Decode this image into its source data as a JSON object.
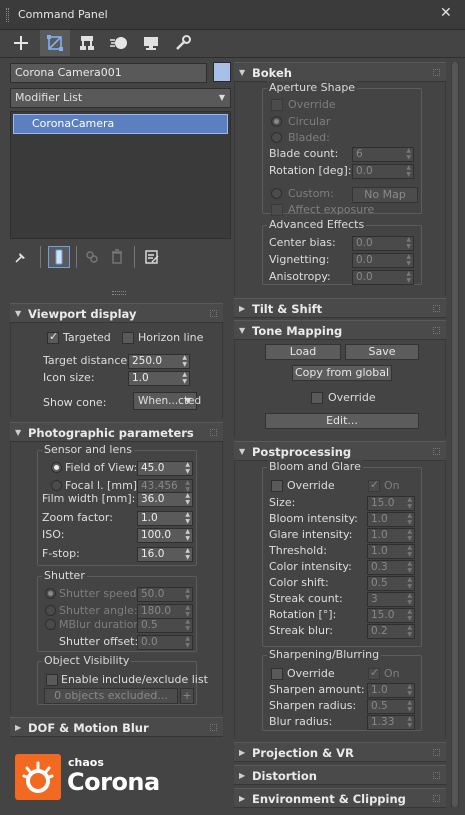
{
  "window": {
    "title": "Command Panel",
    "close": "✕"
  },
  "toolbar": {
    "icons": [
      "create-icon",
      "modify-icon",
      "hierarchy-icon",
      "motion-icon",
      "display-icon",
      "utilities-icon"
    ]
  },
  "object": {
    "name": "Corona Camera001",
    "color": "#a8c0e8"
  },
  "modifier_list": {
    "label": "Modifier List"
  },
  "stack": {
    "items": [
      "CoronaCamera"
    ]
  },
  "left": {
    "viewport_display": {
      "title": "Viewport display",
      "targeted": "Targeted",
      "horizon_line": "Horizon line",
      "target_distance_label": "Target distance:",
      "target_distance": "250.0",
      "icon_size_label": "Icon size:",
      "icon_size": "1.0",
      "show_cone_label": "Show cone:",
      "show_cone_value": "When...cted"
    },
    "photographic": {
      "title": "Photographic parameters",
      "sensor_group": "Sensor and lens",
      "fov_label": "Field of View:",
      "fov": "45.0",
      "focal_label": "Focal l. [mm]:",
      "focal": "43.456",
      "film_width_label": "Film width [mm]:",
      "film_width": "36.0",
      "zoom_label": "Zoom factor:",
      "zoom": "1.0",
      "iso_label": "ISO:",
      "iso": "100.0",
      "fstop_label": "F-stop:",
      "fstop": "16.0",
      "shutter_group": "Shutter",
      "shutter_speed_label": "Shutter speed:",
      "shutter_speed": "50.0",
      "shutter_angle_label": "Shutter angle:",
      "shutter_angle": "180.0",
      "mblur_label": "MBlur duration:",
      "mblur": "0.5",
      "shutter_offset_label": "Shutter offset:",
      "shutter_offset": "0.0",
      "visibility_group": "Object Visibility",
      "include_exclude": "Enable include/exclude list",
      "objects_excluded": "0 objects excluded...",
      "plus": "+"
    },
    "dof": {
      "title": "DOF & Motion Blur"
    }
  },
  "logo": {
    "brand_small": "chaos",
    "brand_big": "Corona"
  },
  "right": {
    "bokeh": {
      "title": "Bokeh",
      "aperture_group": "Aperture Shape",
      "override": "Override",
      "circular": "Circular",
      "bladed": "Bladed:",
      "blade_count_label": "Blade count:",
      "blade_count": "6",
      "rotation_label": "Rotation [deg]:",
      "rotation": "0.0",
      "custom": "Custom:",
      "no_map": "No Map",
      "affect_exposure": "Affect exposure",
      "advanced_group": "Advanced Effects",
      "center_bias_label": "Center bias:",
      "center_bias": "0.0",
      "vignetting_label": "Vignetting:",
      "vignetting": "0.0",
      "anisotropy_label": "Anisotropy:",
      "anisotropy": "0.0"
    },
    "tilt_shift": {
      "title": "Tilt & Shift"
    },
    "tone_mapping": {
      "title": "Tone Mapping",
      "load": "Load",
      "save": "Save",
      "copy_global": "Copy from global",
      "override": "Override",
      "edit": "Edit..."
    },
    "postprocessing": {
      "title": "Postprocessing",
      "bloom_group": "Bloom and Glare",
      "override": "Override",
      "on": "On",
      "size_label": "Size:",
      "size": "15.0",
      "bloom_label": "Bloom intensity:",
      "bloom": "1.0",
      "glare_label": "Glare intensity:",
      "glare": "1.0",
      "threshold_label": "Threshold:",
      "threshold": "1.0",
      "color_intensity_label": "Color intensity:",
      "color_intensity": "0.3",
      "color_shift_label": "Color shift:",
      "color_shift": "0.5",
      "streak_count_label": "Streak count:",
      "streak_count": "3",
      "rotation_label": "Rotation [°]:",
      "rotation": "15.0",
      "streak_blur_label": "Streak blur:",
      "streak_blur": "0.2",
      "sharpen_group": "Sharpening/Blurring",
      "sharpen_amount_label": "Sharpen amount:",
      "sharpen_amount": "1.0",
      "sharpen_radius_label": "Sharpen radius:",
      "sharpen_radius": "0.5",
      "blur_radius_label": "Blur radius:",
      "blur_radius": "1.33"
    },
    "projection": {
      "title": "Projection & VR"
    },
    "distortion": {
      "title": "Distortion"
    },
    "environment": {
      "title": "Environment & Clipping"
    }
  }
}
